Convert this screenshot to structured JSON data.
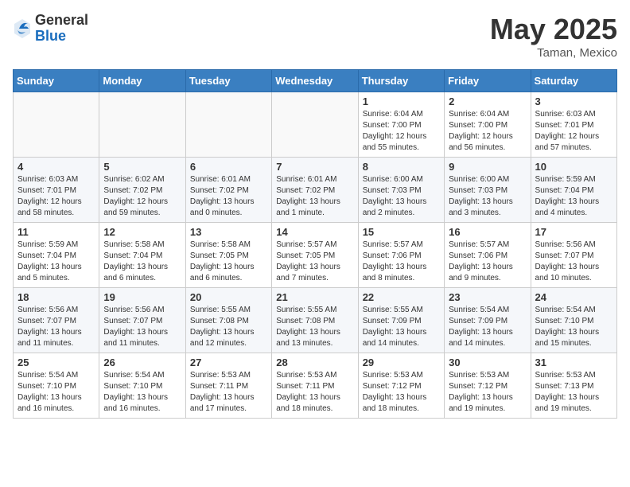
{
  "header": {
    "logo_general": "General",
    "logo_blue": "Blue",
    "month_year": "May 2025",
    "location": "Taman, Mexico"
  },
  "days_of_week": [
    "Sunday",
    "Monday",
    "Tuesday",
    "Wednesday",
    "Thursday",
    "Friday",
    "Saturday"
  ],
  "weeks": [
    [
      {
        "day": "",
        "info": ""
      },
      {
        "day": "",
        "info": ""
      },
      {
        "day": "",
        "info": ""
      },
      {
        "day": "",
        "info": ""
      },
      {
        "day": "1",
        "info": "Sunrise: 6:04 AM\nSunset: 7:00 PM\nDaylight: 12 hours\nand 55 minutes."
      },
      {
        "day": "2",
        "info": "Sunrise: 6:04 AM\nSunset: 7:00 PM\nDaylight: 12 hours\nand 56 minutes."
      },
      {
        "day": "3",
        "info": "Sunrise: 6:03 AM\nSunset: 7:01 PM\nDaylight: 12 hours\nand 57 minutes."
      }
    ],
    [
      {
        "day": "4",
        "info": "Sunrise: 6:03 AM\nSunset: 7:01 PM\nDaylight: 12 hours\nand 58 minutes."
      },
      {
        "day": "5",
        "info": "Sunrise: 6:02 AM\nSunset: 7:02 PM\nDaylight: 12 hours\nand 59 minutes."
      },
      {
        "day": "6",
        "info": "Sunrise: 6:01 AM\nSunset: 7:02 PM\nDaylight: 13 hours\nand 0 minutes."
      },
      {
        "day": "7",
        "info": "Sunrise: 6:01 AM\nSunset: 7:02 PM\nDaylight: 13 hours\nand 1 minute."
      },
      {
        "day": "8",
        "info": "Sunrise: 6:00 AM\nSunset: 7:03 PM\nDaylight: 13 hours\nand 2 minutes."
      },
      {
        "day": "9",
        "info": "Sunrise: 6:00 AM\nSunset: 7:03 PM\nDaylight: 13 hours\nand 3 minutes."
      },
      {
        "day": "10",
        "info": "Sunrise: 5:59 AM\nSunset: 7:04 PM\nDaylight: 13 hours\nand 4 minutes."
      }
    ],
    [
      {
        "day": "11",
        "info": "Sunrise: 5:59 AM\nSunset: 7:04 PM\nDaylight: 13 hours\nand 5 minutes."
      },
      {
        "day": "12",
        "info": "Sunrise: 5:58 AM\nSunset: 7:04 PM\nDaylight: 13 hours\nand 6 minutes."
      },
      {
        "day": "13",
        "info": "Sunrise: 5:58 AM\nSunset: 7:05 PM\nDaylight: 13 hours\nand 6 minutes."
      },
      {
        "day": "14",
        "info": "Sunrise: 5:57 AM\nSunset: 7:05 PM\nDaylight: 13 hours\nand 7 minutes."
      },
      {
        "day": "15",
        "info": "Sunrise: 5:57 AM\nSunset: 7:06 PM\nDaylight: 13 hours\nand 8 minutes."
      },
      {
        "day": "16",
        "info": "Sunrise: 5:57 AM\nSunset: 7:06 PM\nDaylight: 13 hours\nand 9 minutes."
      },
      {
        "day": "17",
        "info": "Sunrise: 5:56 AM\nSunset: 7:07 PM\nDaylight: 13 hours\nand 10 minutes."
      }
    ],
    [
      {
        "day": "18",
        "info": "Sunrise: 5:56 AM\nSunset: 7:07 PM\nDaylight: 13 hours\nand 11 minutes."
      },
      {
        "day": "19",
        "info": "Sunrise: 5:56 AM\nSunset: 7:07 PM\nDaylight: 13 hours\nand 11 minutes."
      },
      {
        "day": "20",
        "info": "Sunrise: 5:55 AM\nSunset: 7:08 PM\nDaylight: 13 hours\nand 12 minutes."
      },
      {
        "day": "21",
        "info": "Sunrise: 5:55 AM\nSunset: 7:08 PM\nDaylight: 13 hours\nand 13 minutes."
      },
      {
        "day": "22",
        "info": "Sunrise: 5:55 AM\nSunset: 7:09 PM\nDaylight: 13 hours\nand 14 minutes."
      },
      {
        "day": "23",
        "info": "Sunrise: 5:54 AM\nSunset: 7:09 PM\nDaylight: 13 hours\nand 14 minutes."
      },
      {
        "day": "24",
        "info": "Sunrise: 5:54 AM\nSunset: 7:10 PM\nDaylight: 13 hours\nand 15 minutes."
      }
    ],
    [
      {
        "day": "25",
        "info": "Sunrise: 5:54 AM\nSunset: 7:10 PM\nDaylight: 13 hours\nand 16 minutes."
      },
      {
        "day": "26",
        "info": "Sunrise: 5:54 AM\nSunset: 7:10 PM\nDaylight: 13 hours\nand 16 minutes."
      },
      {
        "day": "27",
        "info": "Sunrise: 5:53 AM\nSunset: 7:11 PM\nDaylight: 13 hours\nand 17 minutes."
      },
      {
        "day": "28",
        "info": "Sunrise: 5:53 AM\nSunset: 7:11 PM\nDaylight: 13 hours\nand 18 minutes."
      },
      {
        "day": "29",
        "info": "Sunrise: 5:53 AM\nSunset: 7:12 PM\nDaylight: 13 hours\nand 18 minutes."
      },
      {
        "day": "30",
        "info": "Sunrise: 5:53 AM\nSunset: 7:12 PM\nDaylight: 13 hours\nand 19 minutes."
      },
      {
        "day": "31",
        "info": "Sunrise: 5:53 AM\nSunset: 7:13 PM\nDaylight: 13 hours\nand 19 minutes."
      }
    ]
  ]
}
